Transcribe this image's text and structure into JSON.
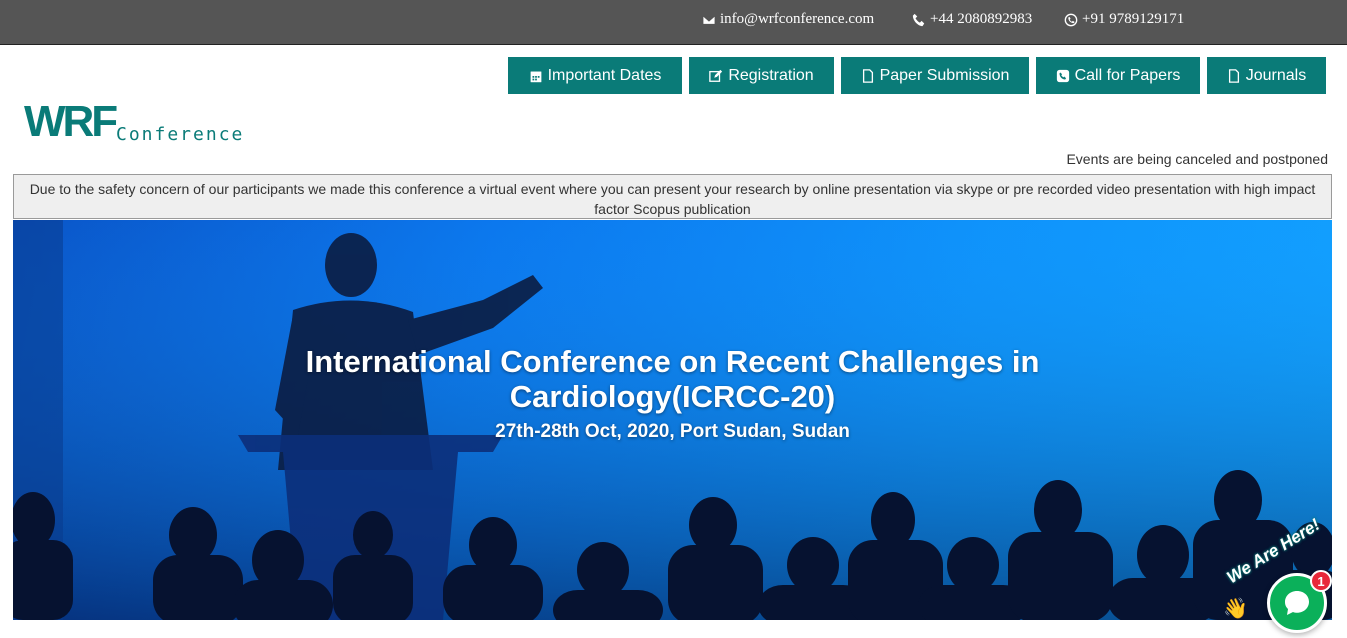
{
  "topbar": {
    "email": "info@wrfconference.com",
    "phone": "+44 2080892983",
    "whatsapp": "+91 9789129171"
  },
  "nav": {
    "important_dates": "Important Dates",
    "registration": "Registration",
    "paper_submission": "Paper Submission",
    "call_for_papers": "Call for Papers",
    "journals": "Journals"
  },
  "logo": {
    "mark": "WRF",
    "word": "Conference"
  },
  "cancel_note": "Events are being canceled and postponed",
  "notice": "Due to the safety concern of our participants we made this conference a virtual event where you can present your research by online presentation via skype or pre recorded video presentation with high impact factor Scopus publication",
  "hero": {
    "title": "International Conference on Recent Challenges in Cardiology(ICRCC-20)",
    "subtitle": "27th-28th Oct, 2020, Port Sudan, Sudan"
  },
  "chat": {
    "label": "We Are Here!",
    "badge": "1"
  },
  "colors": {
    "topbar": "#555555",
    "accent": "#0a7b78",
    "chat": "#0bb05a",
    "badge": "#e8283a"
  }
}
